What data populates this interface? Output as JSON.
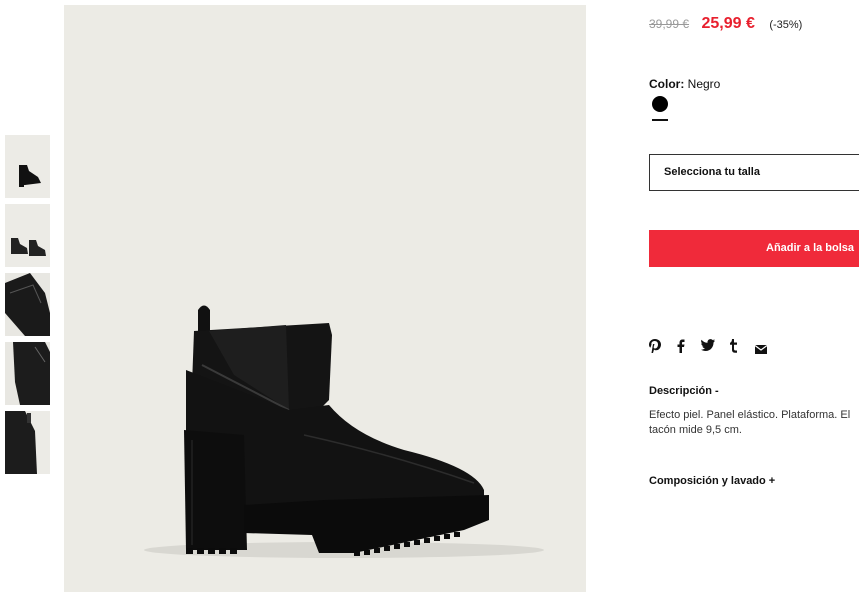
{
  "product": {
    "old_price": "39,99 €",
    "new_price": "25,99 €",
    "discount": "(-35%)",
    "color_label": "Color:",
    "color_value": "Negro",
    "size_placeholder": "Selecciona tu talla",
    "add_to_bag": "Añadir a la bolsa",
    "description_title": "Descripción  -",
    "description_text": "Efecto piel. Panel elástico. Plataforma. El tacón mide 9,5 cm.",
    "composition_title": "Composición y lavado  +"
  },
  "share_icons": [
    "pinterest-icon",
    "facebook-icon",
    "twitter-icon",
    "tumblr-icon",
    "email-icon"
  ],
  "colors": {
    "price_red": "#e8202e",
    "button_red": "#f02a3a",
    "image_bg": "#ecebe5",
    "swatch": "#000000"
  },
  "thumbnails": [
    "thumbnail-1",
    "thumbnail-2",
    "thumbnail-3",
    "thumbnail-4",
    "thumbnail-5"
  ]
}
